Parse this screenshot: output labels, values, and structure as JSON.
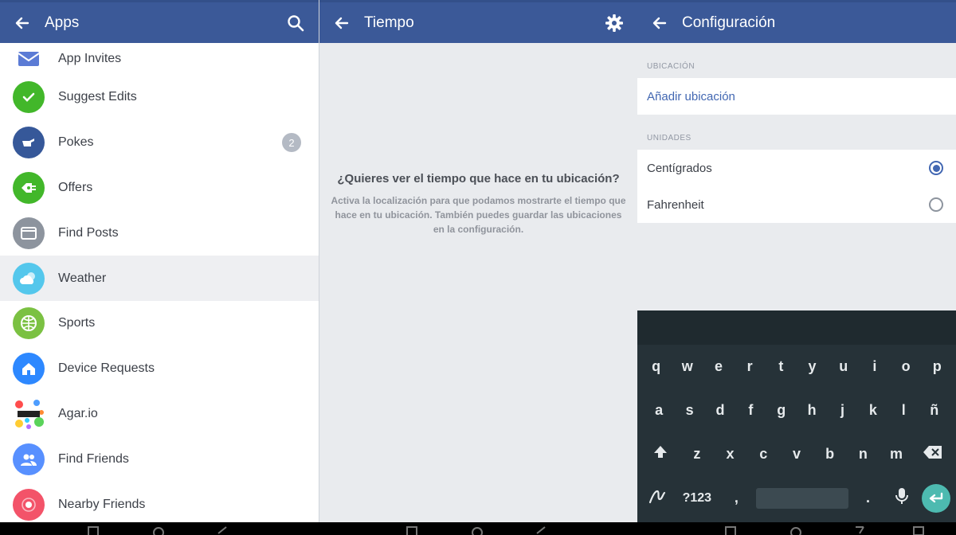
{
  "panel_apps": {
    "title": "Apps",
    "back_icon": "arrow-left-icon",
    "search_icon": "search-icon",
    "items": [
      {
        "label": "App Invites",
        "icon": "envelope-icon",
        "color": "#5b7bd5"
      },
      {
        "label": "Suggest Edits",
        "icon": "check-icon",
        "color": "#42b72a"
      },
      {
        "label": "Pokes",
        "icon": "poke-hand-icon",
        "color": "#365899",
        "badge": "2"
      },
      {
        "label": "Offers",
        "icon": "offer-tag-icon",
        "color": "#42b72a"
      },
      {
        "label": "Find Posts",
        "icon": "window-icon",
        "color": "#8d949e"
      },
      {
        "label": "Weather",
        "icon": "cloud-sun-icon",
        "color": "#54c7ec"
      },
      {
        "label": "Sports",
        "icon": "ball-icon",
        "color": "#7bc142"
      },
      {
        "label": "Device Requests",
        "icon": "house-icon",
        "color": "#2d88ff"
      },
      {
        "label": "Agar.io",
        "icon": "agar-logo-icon",
        "color": "#ffffff"
      },
      {
        "label": "Find Friends",
        "icon": "people-icon",
        "color": "#5890ff"
      },
      {
        "label": "Nearby Friends",
        "icon": "nearby-icon",
        "color": "#f35369"
      }
    ]
  },
  "panel_weather": {
    "title": "Tiempo",
    "settings_icon": "gear-icon",
    "empty_title": "¿Quieres ver el tiempo que hace en tu ubicación?",
    "empty_body": "Activa la localización para que podamos mostrarte el tiempo que hace en tu ubicación. También puedes guardar las ubicaciones en la configuración."
  },
  "panel_config": {
    "title": "Configuración",
    "section_location": "UBICACIÓN",
    "add_location": "Añadir ubicación",
    "section_units": "UNIDADES",
    "unit_celsius": "Centígrados",
    "unit_fahrenheit": "Fahrenheit",
    "selected_unit": "Centígrados"
  },
  "keyboard": {
    "row1": [
      "q",
      "w",
      "e",
      "r",
      "t",
      "y",
      "u",
      "i",
      "o",
      "p"
    ],
    "row2": [
      "a",
      "s",
      "d",
      "f",
      "g",
      "h",
      "j",
      "k",
      "l",
      "ñ"
    ],
    "row3": [
      "z",
      "x",
      "c",
      "v",
      "b",
      "n",
      "m"
    ],
    "symbols_key": "?123",
    "comma_key": ",",
    "period_key": "."
  }
}
